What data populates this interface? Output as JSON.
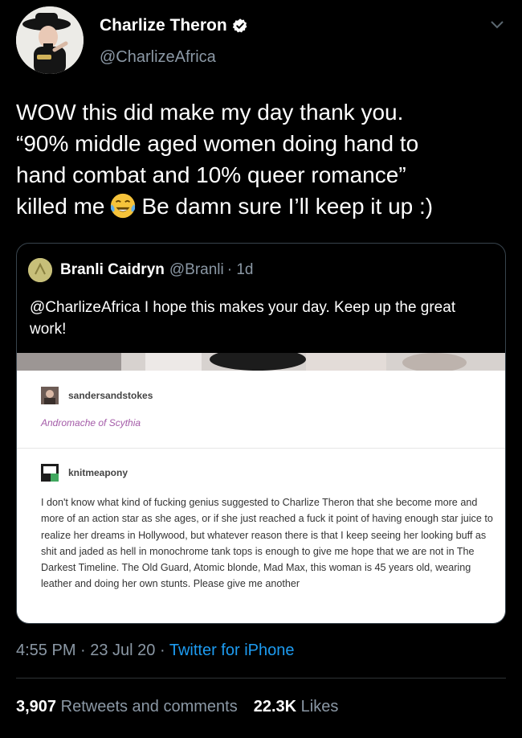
{
  "author": {
    "display_name": "Charlize Theron",
    "handle": "@CharlizeAfrica"
  },
  "tweet": {
    "line1": "WOW this did make my day thank you.",
    "line2": "“90% middle aged women doing hand to",
    "line3": "hand combat and 10% queer romance”",
    "line4_before": "killed me",
    "line4_after": "Be damn sure I’ll keep it up :)",
    "emoji": "tears-of-joy-emoji"
  },
  "quoted": {
    "name": "Branli Caidryn",
    "handle": "@Branli",
    "age": "· 1d",
    "mention": "@CharlizeAfrica",
    "text": " I hope this makes your day. Keep up the great work!",
    "embed": {
      "user1": "sandersandstokes",
      "title": "Andromache of Scythia",
      "user2": "knitmeapony",
      "body": "I don't know what kind of fucking genius suggested to Charlize Theron that she become more and more of an action star as she ages, or if she just reached a fuck it point of having enough star juice to realize her dreams in Hollywood, but whatever reason there is that I keep seeing her looking buff as shit and jaded as hell in monochrome tank tops is enough to give me hope that we are not in The Darkest Timeline. The Old Guard, Atomic blonde, Mad Max, this woman is 45 years old, wearing leather and doing her own stunts. Please give me another"
    }
  },
  "meta": {
    "time_date": "4:55 PM · 23 Jul 20 · ",
    "source": "Twitter for iPhone"
  },
  "stats": {
    "retweets_count": "3,907",
    "retweets_label": "Retweets and comments",
    "likes_count": "22.3K",
    "likes_label": "Likes"
  },
  "colors": {
    "background": "#000000",
    "link": "#1d9bf0",
    "secondary_text": "#8b98a5",
    "border": "#38444d",
    "tumblr_title": "#a45ba8"
  }
}
